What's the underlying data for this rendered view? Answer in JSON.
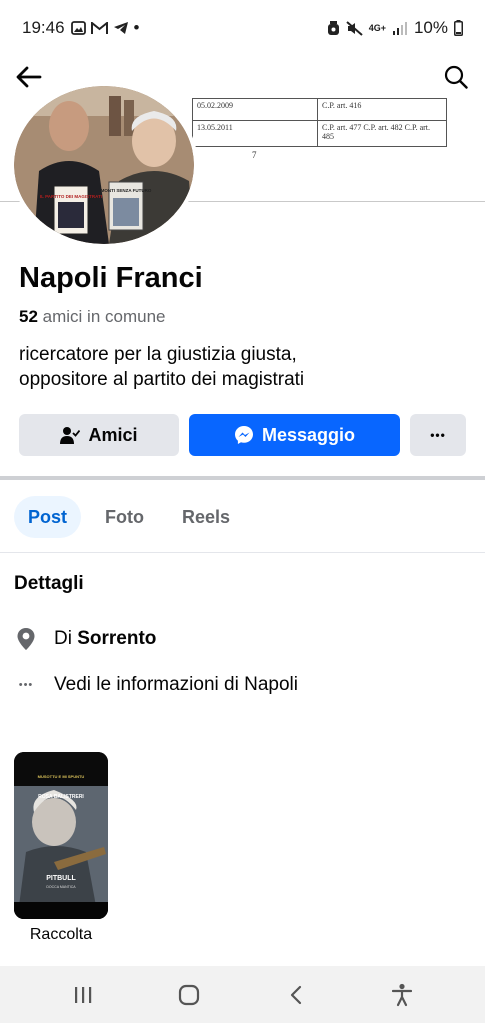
{
  "status_bar": {
    "time": "19:46",
    "dot": "•",
    "network": "4G+",
    "battery": "10%",
    "icons": [
      "gallery-icon",
      "gmail-icon",
      "telegram-icon",
      "alarm-icon",
      "mute-icon",
      "signal-icon",
      "battery-icon"
    ]
  },
  "top_bar": {
    "back_icon": "arrow-left-icon",
    "search_icon": "search-icon"
  },
  "cover": {
    "table_rows": [
      [
        "05.02.2009",
        "C.P. art. 416"
      ],
      [
        "13.05.2011",
        "C.P. art. 477 C.P. art. 482 C.P. art. 485"
      ]
    ],
    "page_number": "7"
  },
  "avatar": {
    "book_left": "IL PARTITO DEI MAGISTRATI",
    "book_right": "MONTI SENZA FUTURO"
  },
  "profile": {
    "name": "Napoli Franci",
    "mutual_count": "52",
    "mutual_text": "amici in comune",
    "bio_line1": "ricercatore per la giustizia giusta,",
    "bio_line2": "oppositore al partito dei magistrati"
  },
  "actions": {
    "friends_label": "Amici",
    "message_label": "Messaggio",
    "more_label": "•••",
    "friends_icon": "person-check-icon",
    "message_icon": "messenger-icon"
  },
  "tabs": [
    {
      "label": "Post",
      "active": true
    },
    {
      "label": "Foto",
      "active": false
    },
    {
      "label": "Reels",
      "active": false
    }
  ],
  "details": {
    "title": "Dettagli",
    "city_prefix": "Di",
    "city": "Sorrento",
    "more_info": "Vedi le informazioni di Napoli",
    "more_icon": "•••"
  },
  "collection": {
    "label": "Raccolta",
    "art_title": "ROSA BALISTRERI",
    "art_subtitle": "MUSOTTU E MI SPUNTU",
    "art_bottom": "PITBULL",
    "art_bottom_sub": "DOCCA MANTICA"
  },
  "colors": {
    "accent": "#0866ff",
    "tab_active_bg": "#ebf5ff",
    "tab_active_text": "#0064d1",
    "secondary_text": "#65676b",
    "button_gray": "#e4e6eb"
  }
}
